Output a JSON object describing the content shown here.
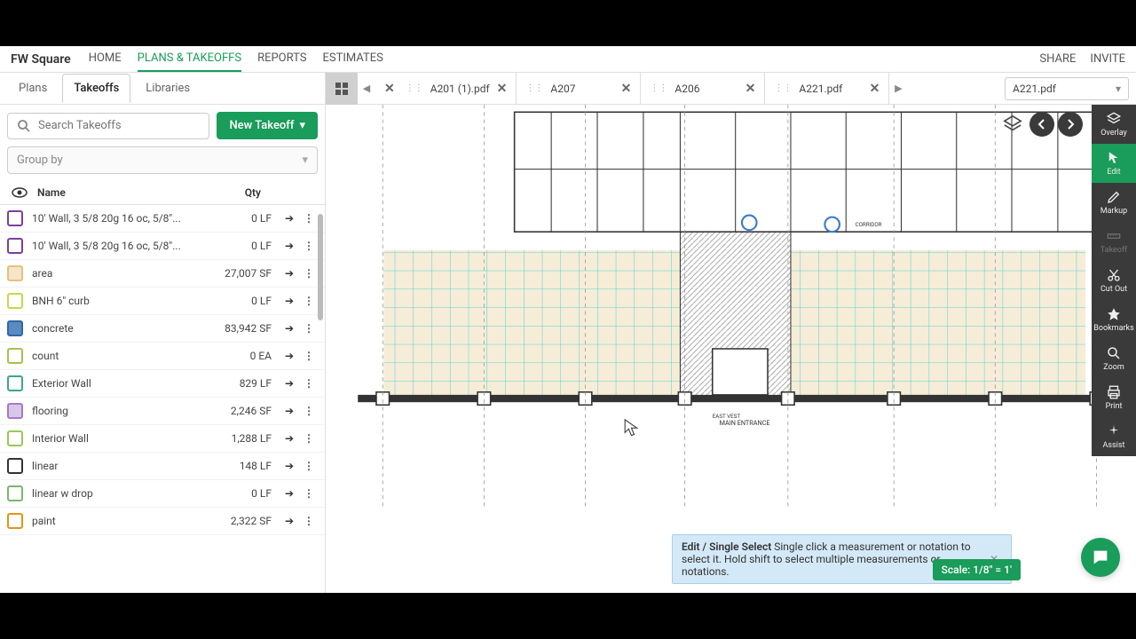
{
  "app_title": "FW Square",
  "top_nav": [
    "HOME",
    "PLANS & TAKEOFFS",
    "REPORTS",
    "ESTIMATES"
  ],
  "top_nav_active": 1,
  "top_right": [
    "SHARE",
    "INVITE"
  ],
  "left_tabs": [
    "Plans",
    "Takeoffs",
    "Libraries"
  ],
  "left_tabs_active": 1,
  "doc_tabs": [
    {
      "label": "A201 (1).pdf"
    },
    {
      "label": "A207"
    },
    {
      "label": "A206"
    },
    {
      "label": "A221.pdf"
    }
  ],
  "doc_dropdown": "A221.pdf",
  "search": {
    "placeholder": "Search Takeoffs"
  },
  "new_takeoff_label": "New Takeoff",
  "groupby_placeholder": "Group by",
  "columns": {
    "name": "Name",
    "qty": "Qty"
  },
  "takeoffs": [
    {
      "name": "10' Wall, 3 5/8 20g 16 oc, 5/8\"...",
      "qty": "0 LF",
      "color": "#7a3fa0",
      "fill": "#fff"
    },
    {
      "name": "10' Wall, 3 5/8 20g 16 oc, 5/8\"...",
      "qty": "0 LF",
      "color": "#7a3fa0",
      "fill": "#fff"
    },
    {
      "name": "area",
      "qty": "27,007 SF",
      "color": "#e8c080",
      "fill": "#f5e6c8"
    },
    {
      "name": "BNH 6\" curb",
      "qty": "0 LF",
      "color": "#c5d94a",
      "fill": "#fff"
    },
    {
      "name": "concrete",
      "qty": "83,942 SF",
      "color": "#2a6aa8",
      "fill": "#5a8ac0"
    },
    {
      "name": "count",
      "qty": "0 EA",
      "color": "#a8c050",
      "fill": "#fff"
    },
    {
      "name": "Exterior Wall",
      "qty": "829 LF",
      "color": "#3aa88a",
      "fill": "#fff"
    },
    {
      "name": "flooring",
      "qty": "2,246 SF",
      "color": "#a878c8",
      "fill": "#d8c8e8"
    },
    {
      "name": "Interior Wall",
      "qty": "1,288 LF",
      "color": "#9ac85a",
      "fill": "#fff"
    },
    {
      "name": "linear",
      "qty": "148 LF",
      "color": "#333",
      "fill": "#fff"
    },
    {
      "name": "linear w drop",
      "qty": "0 LF",
      "color": "#7ab86a",
      "fill": "#fff"
    },
    {
      "name": "paint",
      "qty": "2,322 SF",
      "color": "#e0951a",
      "fill": "#fff"
    }
  ],
  "right_tools": [
    {
      "name": "Overlay",
      "icon": "layers"
    },
    {
      "name": "Edit",
      "icon": "cursor",
      "active": true
    },
    {
      "name": "Markup",
      "icon": "pencil"
    },
    {
      "name": "Takeoff",
      "icon": "ruler",
      "disabled": true
    },
    {
      "name": "Cut Out",
      "icon": "scissors"
    },
    {
      "name": "Bookmarks",
      "icon": "star"
    },
    {
      "name": "Zoom",
      "icon": "search"
    },
    {
      "name": "Print",
      "icon": "print"
    },
    {
      "name": "Assist",
      "icon": "sparkle"
    }
  ],
  "info_bar": {
    "title": "Edit / Single Select",
    "text": " Single click a measurement or notation to select it. Hold shift to select multiple measurements or notations."
  },
  "scale_label": "Scale: 1/8\" = 1'",
  "plan_labels": {
    "main_entrance": "MAIN ENTRANCE",
    "corridor": "CORRIDOR",
    "east_vest": "EAST VEST"
  }
}
